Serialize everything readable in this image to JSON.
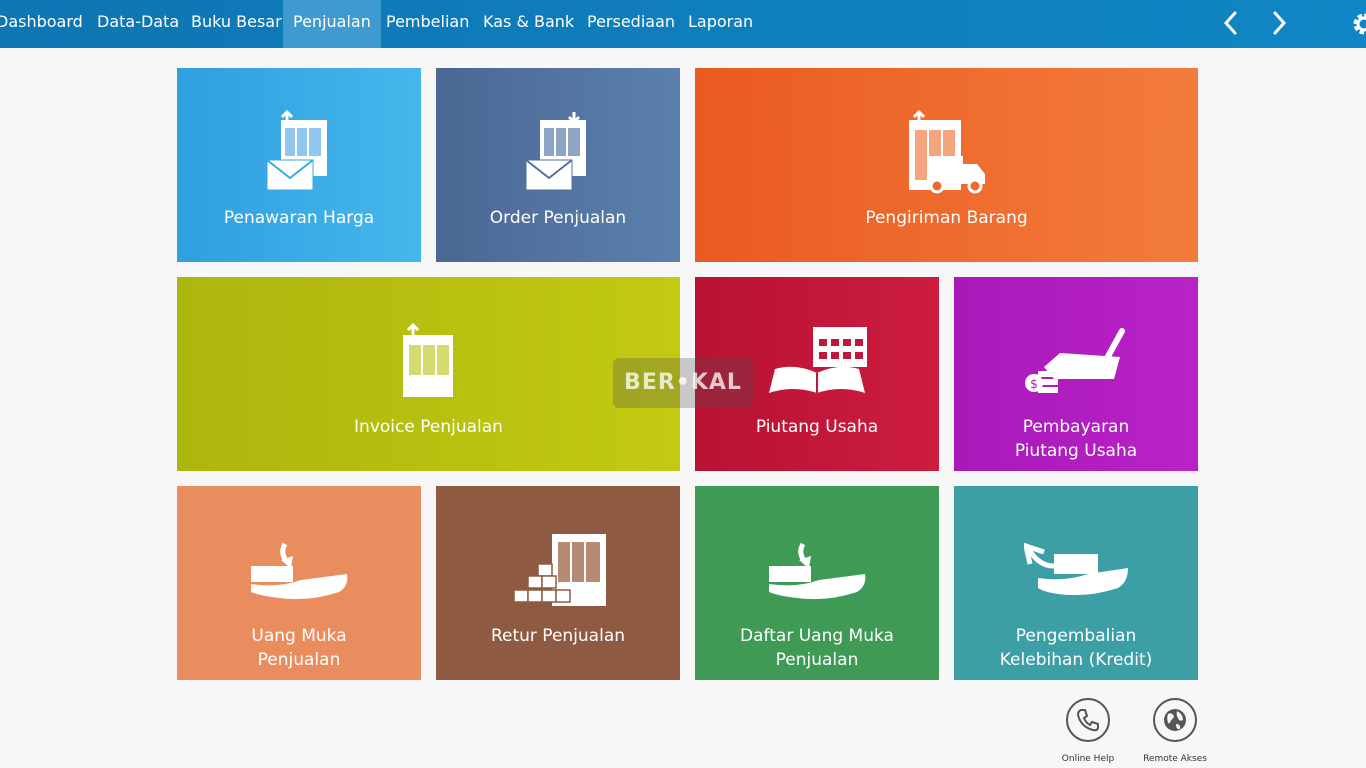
{
  "menu": {
    "items": [
      {
        "label": "Dashboard"
      },
      {
        "label": "Data-Data"
      },
      {
        "label": "Buku Besar"
      },
      {
        "label": "Penjualan"
      },
      {
        "label": "Pembelian"
      },
      {
        "label": "Kas & Bank"
      },
      {
        "label": "Persediaan"
      },
      {
        "label": "Laporan"
      }
    ],
    "active": "Penjualan"
  },
  "tiles": {
    "penawaran_harga": {
      "line1": "Penawaran Harga",
      "color": "#3aa9e4"
    },
    "order_penjualan": {
      "line1": "Order Penjualan",
      "color": "#51719e"
    },
    "pengiriman_barang": {
      "line1": "Pengiriman Barang",
      "color": "#ef6a2c"
    },
    "invoice_penjualan": {
      "line1": "Invoice Penjualan",
      "color": "#b6c20f"
    },
    "piutang_usaha": {
      "line1": "Piutang Usaha",
      "color": "#c0163a"
    },
    "pembayaran_piutang": {
      "line1": "Pembayaran",
      "line2": "Piutang Usaha",
      "color": "#b01bbf"
    },
    "uang_muka": {
      "line1": "Uang Muka",
      "line2": "Penjualan",
      "color": "#ea8d5e"
    },
    "retur_penjualan": {
      "line1": "Retur Penjualan",
      "color": "#8f5a42"
    },
    "daftar_uang_muka": {
      "line1": "Daftar Uang Muka",
      "line2": "Penjualan",
      "color": "#3f9a56"
    },
    "pengembalian": {
      "line1": "Pengembalian",
      "line2": "Kelebihan (Kredit)",
      "color": "#3c9fa6"
    }
  },
  "watermark": "BER•KAL",
  "bottom": {
    "online_help": "Online Help",
    "remote_akses": "Remote Akses"
  },
  "icons": {
    "prev": "chevron-left-icon",
    "next": "chevron-right-icon",
    "settings": "gear-icon",
    "phone": "phone-icon",
    "globe": "globe-icon"
  }
}
